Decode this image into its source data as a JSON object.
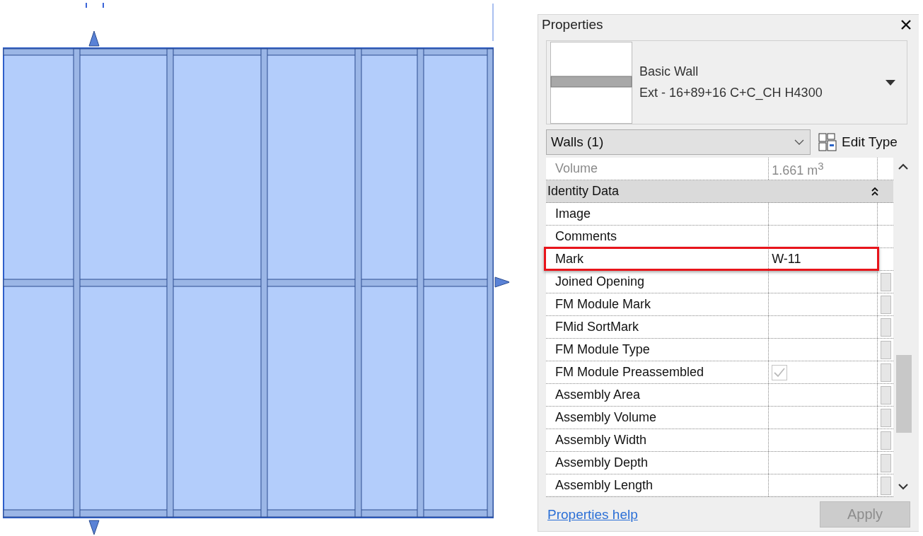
{
  "panel": {
    "title": "Properties",
    "type_selector": {
      "family": "Basic Wall",
      "type": "Ext - 16+89+16 C+C_CH H4300"
    },
    "filter": {
      "value": "Walls (1)"
    },
    "edit_type": {
      "label": "Edit Type"
    },
    "rows": [
      {
        "kind": "param",
        "label": "Volume",
        "value": "1.661 m$^{3}$",
        "disabled": true,
        "highlighted": false,
        "side_button": false
      },
      {
        "kind": "group",
        "label": "Identity Data",
        "expanded": true
      },
      {
        "kind": "param",
        "label": "Image",
        "disabled": false,
        "highlighted": false,
        "side_button": false
      },
      {
        "kind": "param",
        "label": "Comments",
        "disabled": false,
        "highlighted": false,
        "side_button": false
      },
      {
        "kind": "param",
        "label": "Mark",
        "value": "W-11",
        "disabled": false,
        "highlighted": true,
        "side_button": false
      },
      {
        "kind": "param",
        "label": "Joined Opening",
        "disabled": false,
        "highlighted": false,
        "side_button": true
      },
      {
        "kind": "param",
        "label": "FM Module Mark",
        "disabled": false,
        "highlighted": false,
        "side_button": true
      },
      {
        "kind": "param",
        "label": "FMid SortMark",
        "disabled": false,
        "highlighted": false,
        "side_button": true
      },
      {
        "kind": "param",
        "label": "FM Module Type",
        "disabled": false,
        "highlighted": false,
        "side_button": true
      },
      {
        "kind": "checkbox",
        "label": "FM Module Preassembled",
        "checked": true,
        "disabled": true,
        "highlighted": false,
        "side_button": true
      },
      {
        "kind": "param",
        "label": "Assembly Area",
        "disabled": false,
        "highlighted": false,
        "side_button": true
      },
      {
        "kind": "param",
        "label": "Assembly Volume",
        "disabled": false,
        "highlighted": false,
        "side_button": true
      },
      {
        "kind": "param",
        "label": "Assembly Width",
        "disabled": false,
        "highlighted": false,
        "side_button": true
      },
      {
        "kind": "param",
        "label": "Assembly Depth",
        "disabled": false,
        "highlighted": false,
        "side_button": true
      },
      {
        "kind": "param",
        "label": "Assembly Length",
        "disabled": false,
        "highlighted": false,
        "side_button": true
      }
    ],
    "help_link": "Properties help",
    "apply": {
      "label": "Apply",
      "disabled": true
    }
  }
}
